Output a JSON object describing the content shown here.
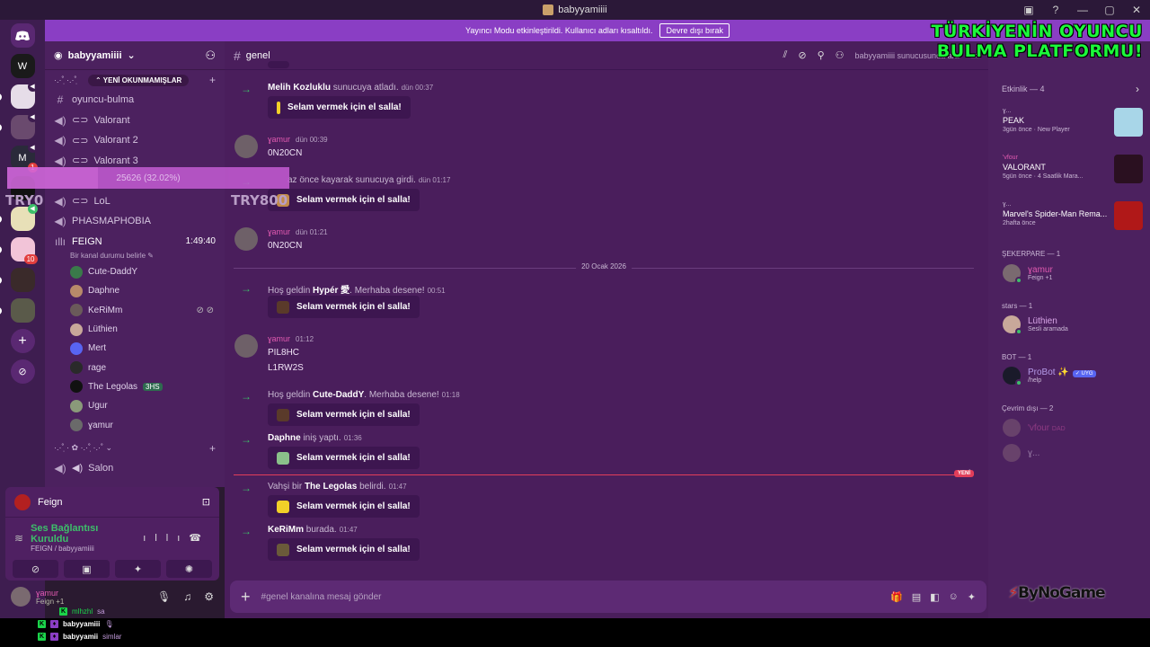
{
  "window": {
    "title": "babyyamiiii",
    "controls": [
      "▣",
      "?",
      "—",
      "▢",
      "✕"
    ]
  },
  "overlay_title": {
    "line1": "TÜRKİYENİN OYUNCU",
    "line2": "BULMA PLATFORMU!"
  },
  "banner": {
    "text": "Yayıncı Modu etkinleştirildi. Kullanıcı adları kısaltıldı.",
    "button": "Devre dışı bırak"
  },
  "guilds": [
    {
      "label": "W",
      "badge": "",
      "voice": false
    },
    {
      "label": "",
      "badge": "",
      "voice": true
    },
    {
      "label": "",
      "badge": "",
      "voice": true
    },
    {
      "label": "M",
      "badge": "1",
      "voice": true
    },
    {
      "label": "",
      "badge": "",
      "voice": false
    },
    {
      "label": "",
      "badge": "",
      "voice": true
    },
    {
      "label": "",
      "badge": "10",
      "voice": false
    },
    {
      "label": "",
      "badge": "",
      "voice": false
    },
    {
      "label": "",
      "badge": "",
      "voice": false
    }
  ],
  "server": {
    "name": "babyyamiiii"
  },
  "categories": {
    "first": "·.·˚ ̣·.·˚ ̣",
    "unread_pill": "⌃ YENİ OKUNMAMIŞLAR",
    "second": "·.·˚ ̣· ✿ ·.·˚ ̣·.·˚ ⌄"
  },
  "channels": [
    {
      "sym": "#",
      "name": "oyuncu-bulma"
    },
    {
      "sym": "🔊",
      "name": "Valorant"
    },
    {
      "sym": "🔊",
      "name": "Valorant 2"
    },
    {
      "sym": "🔊",
      "name": "Valorant 3"
    },
    {
      "sym": "🔊",
      "name": "LoL"
    },
    {
      "sym": "🔊",
      "name": "PHASMAPHOBIA"
    }
  ],
  "voice_channel": {
    "name": "FEIGN",
    "time": "1:49:40",
    "status": "Bir kanal durumu belirle ✎"
  },
  "voice_users": [
    {
      "name": "Cute-DaddY",
      "tag": ""
    },
    {
      "name": "Daphne",
      "tag": ""
    },
    {
      "name": "KeRiMm",
      "tag": "",
      "icons": "⊘ ⊘"
    },
    {
      "name": "Lüthien",
      "tag": ""
    },
    {
      "name": "Mert",
      "tag": ""
    },
    {
      "name": "rage",
      "tag": ""
    },
    {
      "name": "The Legolas",
      "tag": "3HS"
    },
    {
      "name": "Ugur",
      "tag": ""
    },
    {
      "name": "ɣamur",
      "tag": ""
    }
  ],
  "salon": {
    "name": "Salon"
  },
  "scroll_overlay": {
    "text": "25626 (32.02%)",
    "progress": 0.3202
  },
  "try_labels": {
    "left": "TRY0",
    "right": "TRY800"
  },
  "voice_panel": {
    "title": "Feign",
    "connected": "Ses Bağlantısı Kuruldu",
    "server": "FEIGN / babyyamiiii"
  },
  "user": {
    "name": "ɣamur",
    "status": "Feign +1"
  },
  "chat": {
    "channel": "genel",
    "search": "babyyamiiii sunucusunda ara",
    "messages": {
      "m1": {
        "user": "Melih Kozluklu",
        "text": "sunucuya atladı.",
        "time": "dün 00:37"
      },
      "m2": {
        "user": "ɣamur",
        "time": "dün 00:39",
        "text": "0N20CN"
      },
      "m3": {
        "prefix": "az önce kayarak sunucuya girdi.",
        "time": "dün 01:17"
      },
      "m4": {
        "user": "ɣamur",
        "time": "dün 01:21",
        "text": "0N20CN"
      },
      "date_divider": "20 Ocak 2026",
      "m5": {
        "pre": "Hoş geldin",
        "user": "Hypér 愛",
        "post": ". Merhaba desene!",
        "time": "00:51"
      },
      "m6": {
        "user": "ɣamur",
        "time": "01:12",
        "line1": "PIL8HC",
        "line2": "L1RW2S"
      },
      "m7": {
        "pre": "Hoş geldin",
        "user": "Cute-DaddY",
        "post": ". Merhaba desene!",
        "time": "01:18"
      },
      "m8": {
        "user": "Daphne",
        "post": "iniş yaptı.",
        "time": "01:36"
      },
      "new_label": "YENİ",
      "m9": {
        "pre": "Vahşi bir",
        "user": "The Legolas",
        "post": "belirdi.",
        "time": "01:47"
      },
      "m10": {
        "user": "KeRiMm",
        "post": "burada.",
        "time": "01:47"
      }
    },
    "wave_label": "Selam vermek için el salla!",
    "composer_placeholder": "#genel kanalına mesaj gönder"
  },
  "activity": {
    "header": "Etkinlik — 4",
    "items": [
      {
        "who": "ɣ...",
        "game": "PEAK",
        "meta": "3gün önce · New Player",
        "color": "#a8d6e8"
      },
      {
        "who": "'vfour",
        "game": "VALORANT",
        "meta": "5gün önce · 4 Saatlik Mara...",
        "color": "#2a1020"
      },
      {
        "who": "ɣ...",
        "game": "Marvel's Spider-Man Rema...",
        "meta": "2hafta önce",
        "color": "#b01818"
      }
    ]
  },
  "member_groups": {
    "g1": "ŞEKERPARE — 1",
    "g2": "stars — 1",
    "g3": "BOT — 1",
    "g4": "Çevrim dışı — 2"
  },
  "members": {
    "yamur": {
      "name": "ɣamur",
      "sub": "Feign +1"
    },
    "luthien": {
      "name": "Lüthien",
      "sub": "Sesli aramada"
    },
    "probot": {
      "name": "ProBot ✨",
      "tag": "✓ UYG",
      "sub": "/help"
    },
    "vfour": {
      "name": "'vfour",
      "sub": "DAD"
    },
    "w": {
      "name": "ɣ..."
    }
  },
  "brand": {
    "text1": "ByNo",
    "text2": "Game"
  },
  "stream_chat": [
    {
      "user": "mlhzhl",
      "msg": "sa"
    },
    {
      "user": "babyyamiii",
      "msg": "🎙"
    },
    {
      "user": "babyyamii",
      "msg": "simlar"
    }
  ]
}
